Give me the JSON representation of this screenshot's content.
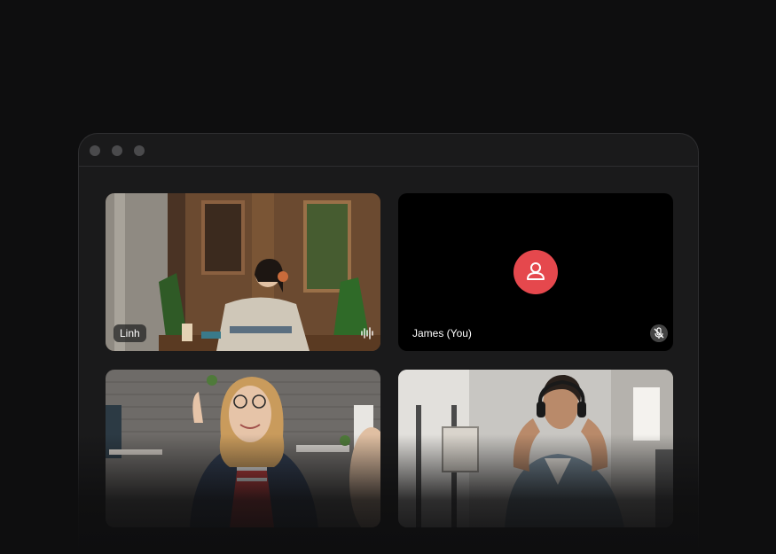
{
  "window": {
    "controls": [
      "close",
      "minimize",
      "maximize"
    ]
  },
  "participants": [
    {
      "name": "Linh",
      "status_icon": "audio-waveform-icon"
    },
    {
      "name": "James (You)",
      "status_icon": "mic-muted-icon",
      "video": "off",
      "avatar_color": "#e5484d"
    },
    {
      "name": ""
    },
    {
      "name": ""
    }
  ],
  "colors": {
    "background": "#0e0e0f",
    "window": "#1a1a1b",
    "avatar": "#e5484d"
  }
}
